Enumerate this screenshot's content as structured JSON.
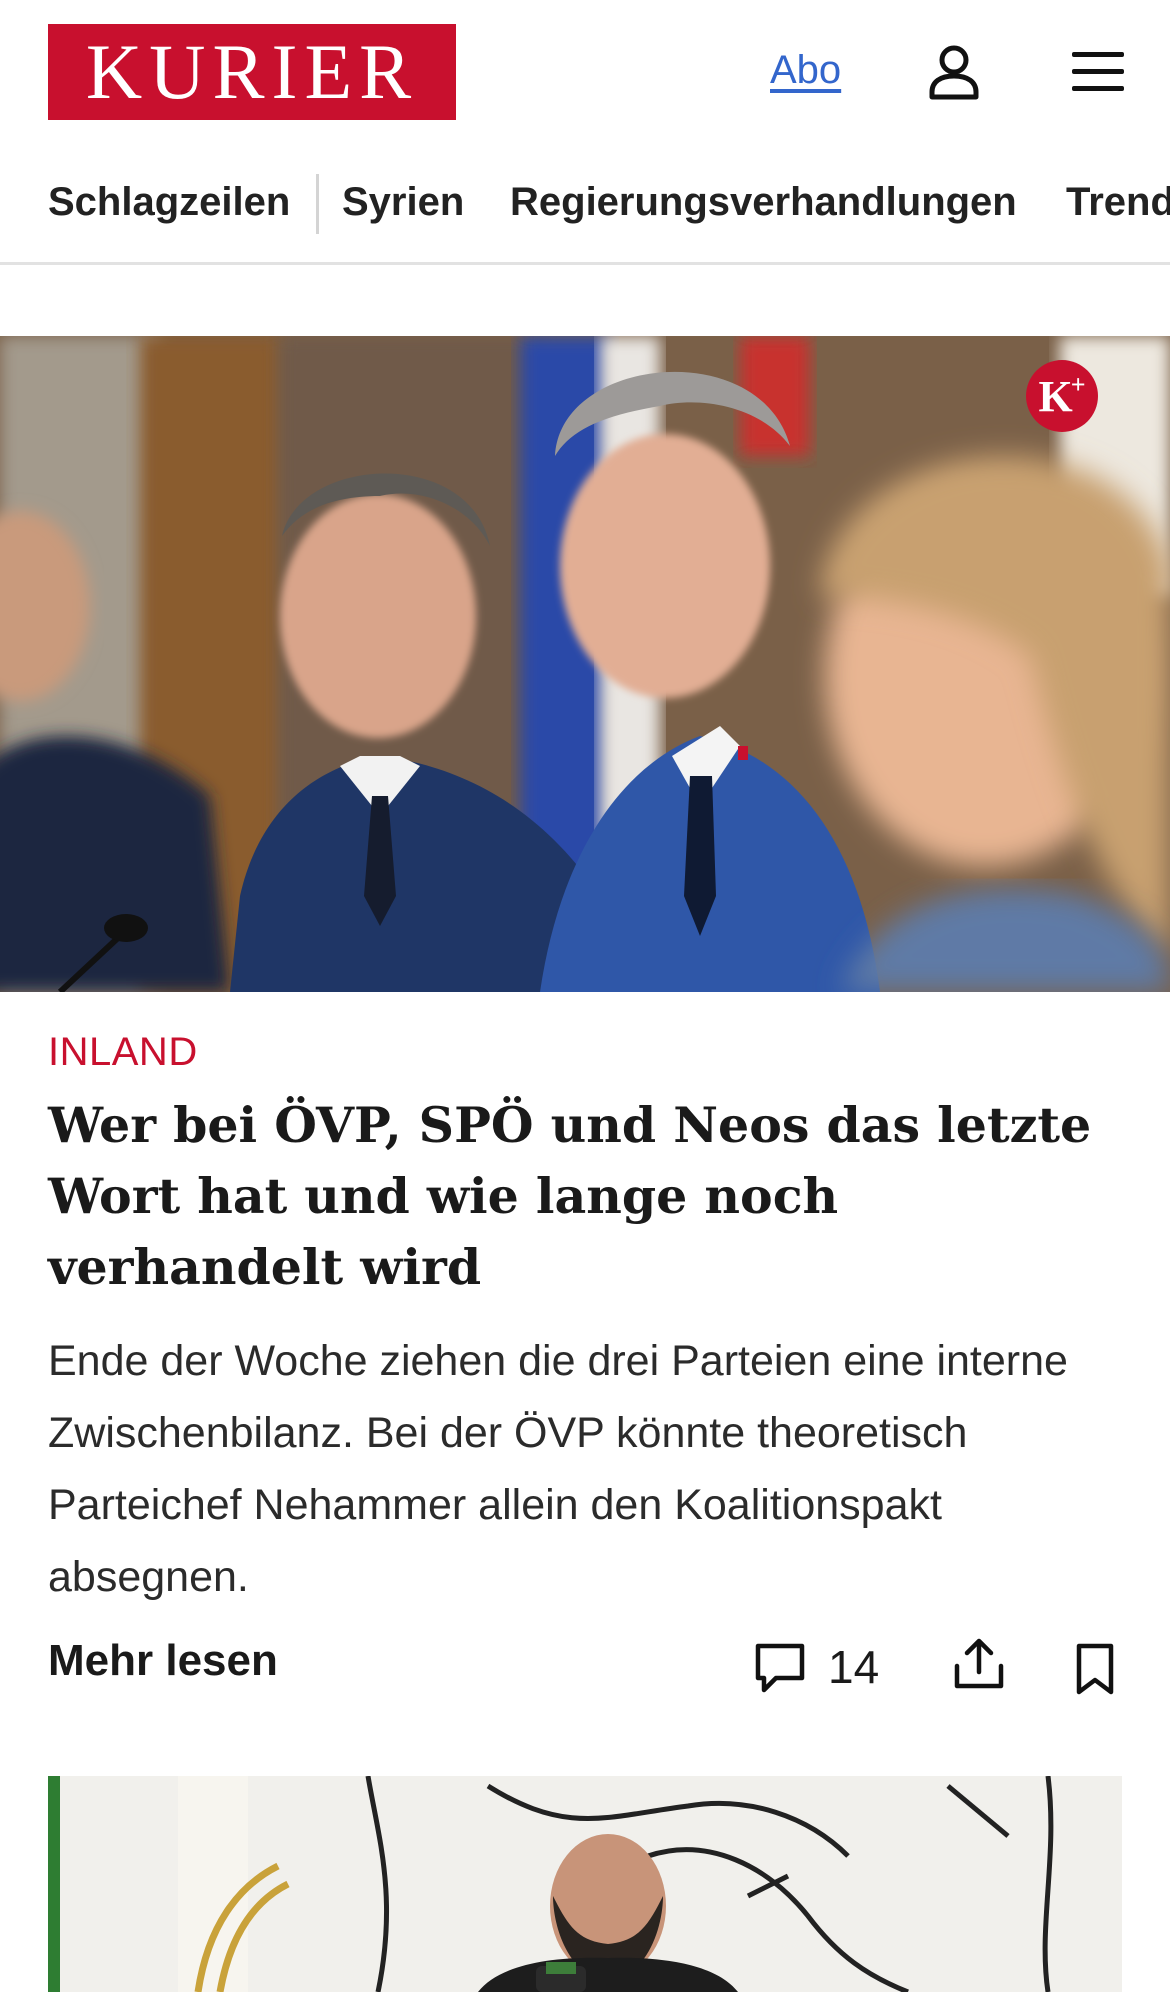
{
  "header": {
    "logo_text": "KURIER",
    "abo_label": "Abo",
    "icons": {
      "account": "user-icon",
      "menu": "hamburger-menu-icon"
    },
    "brand_color": "#c8102e",
    "link_color": "#3366cc"
  },
  "topnav": {
    "items": [
      {
        "label": "Schlagzeilen"
      },
      {
        "label": "Syrien"
      },
      {
        "label": "Regierungsverhandlungen"
      },
      {
        "label": "Trend"
      }
    ]
  },
  "article": {
    "premium_badge": "K",
    "category": "INLAND",
    "headline": "Wer bei ÖVP, SPÖ und Neos das letzte Wort hat und wie lange noch verhandelt wird",
    "teaser": "Ende der Woche ziehen die drei Parteien eine interne Zwischenbilanz. Bei der ÖVP könnte theoretisch Parteichef Nehammer allein den Koalitionspakt absegnen.",
    "more_label": "Mehr lesen",
    "comment_count": "14",
    "icons": {
      "comments": "comment-icon",
      "share": "share-icon",
      "bookmark": "bookmark-icon"
    }
  }
}
